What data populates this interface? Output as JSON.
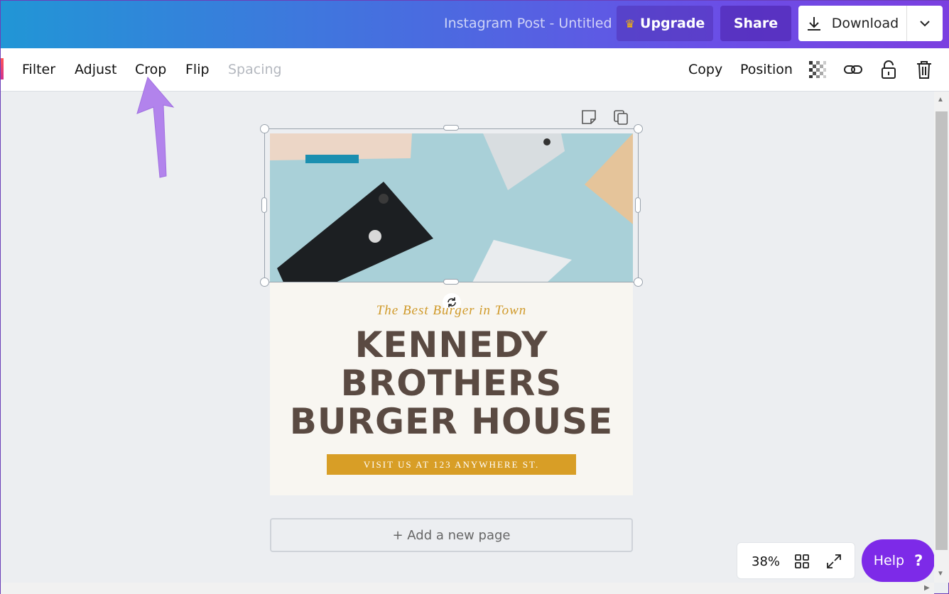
{
  "header": {
    "doc_title": "Instagram Post - Untitled",
    "upgrade_label": "Upgrade",
    "share_label": "Share",
    "download_label": "Download"
  },
  "toolbar": {
    "filter": "Filter",
    "adjust": "Adjust",
    "crop": "Crop",
    "flip": "Flip",
    "spacing": "Spacing",
    "copy": "Copy",
    "position": "Position"
  },
  "design": {
    "tagline": "The Best Burger in Town",
    "headline_line1": "KENNEDY",
    "headline_line2": "BROTHERS",
    "headline_line3": "BURGER HOUSE",
    "cta": "VISIT US AT 123 ANYWHERE ST."
  },
  "add_page_label": "+ Add a new page",
  "zoom": {
    "value": "38%"
  },
  "help": {
    "label": "Help",
    "mark": "?"
  },
  "colors": {
    "accent_purple": "#7d2ae8",
    "headline": "#5a4a42",
    "gold": "#d89e26"
  }
}
